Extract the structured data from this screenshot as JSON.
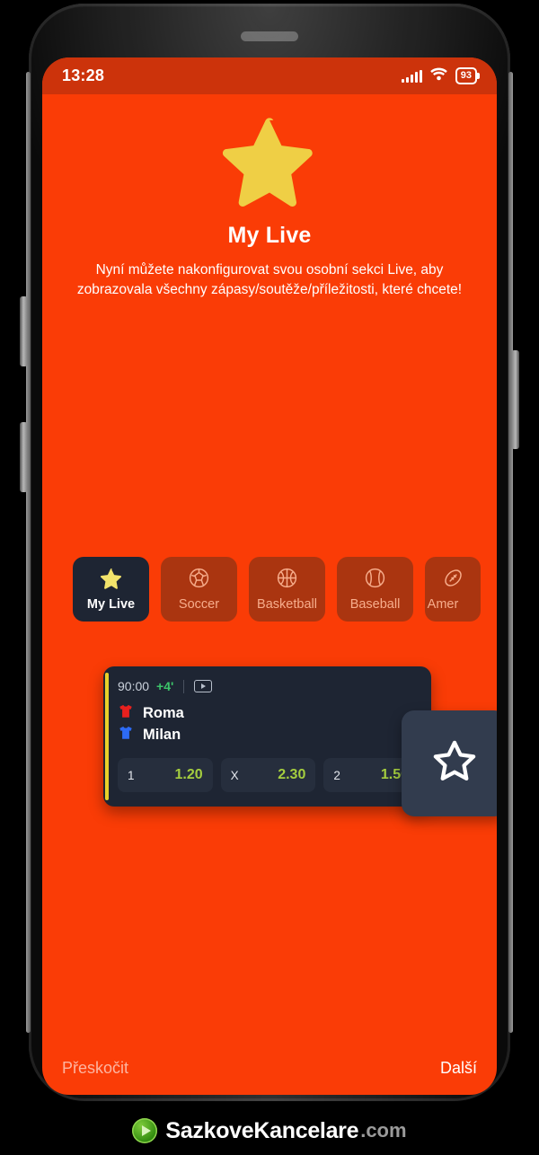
{
  "status_bar": {
    "time": "13:28",
    "battery_level": "93",
    "signal_icon": "signal-bars-icon",
    "wifi_icon": "wifi-icon",
    "battery_icon": "battery-icon"
  },
  "hero": {
    "star_icon": "star-filled-icon",
    "title": "My Live",
    "subtitle": "Nyní můžete nakonfigurovat svou osobní sekci Live, aby zobrazovala všechny zápasy/soutěže/příležitosti, které chcete!"
  },
  "tabs": [
    {
      "label": "My Live",
      "icon": "star-filled-icon",
      "active": true
    },
    {
      "label": "Soccer",
      "icon": "soccer-ball-icon",
      "active": false
    },
    {
      "label": "Basketball",
      "icon": "basketball-icon",
      "active": false
    },
    {
      "label": "Baseball",
      "icon": "baseball-icon",
      "active": false
    },
    {
      "label": "Amer",
      "icon": "american-football-icon",
      "active": false
    }
  ],
  "match_card": {
    "time": "90:00",
    "extra_time": "+4'",
    "stream_icon": "video-stream-icon",
    "teams": [
      {
        "name": "Roma",
        "jersey_icon": "jersey-icon",
        "jersey_color": "#E8201E"
      },
      {
        "name": "Milan",
        "jersey_icon": "jersey-icon",
        "jersey_color": "#2D6BF5"
      }
    ],
    "odds": [
      {
        "key": "1",
        "value": "1.20"
      },
      {
        "key": "X",
        "value": "2.30"
      },
      {
        "key": "2",
        "value": "1.50"
      }
    ],
    "accent_color": "#E8D02A"
  },
  "favorite_button": {
    "icon": "star-outline-icon"
  },
  "bottom_nav": {
    "skip_label": "Přeskočit",
    "next_label": "Další"
  },
  "footer": {
    "play_icon": "play-circle-icon",
    "brand": "SazkoveKancelare",
    "tld": ".com"
  },
  "colors": {
    "screen_bg": "#FA3C06",
    "status_bar_bg": "#CC330B",
    "tab_inactive_bg": "#AA3510",
    "tab_inactive_text": "#F7AD8C",
    "card_bg": "#1E2533",
    "odds_value": "#A5CE3F",
    "extra_time": "#3CC46A",
    "star_yellow": "#EFCF45"
  }
}
